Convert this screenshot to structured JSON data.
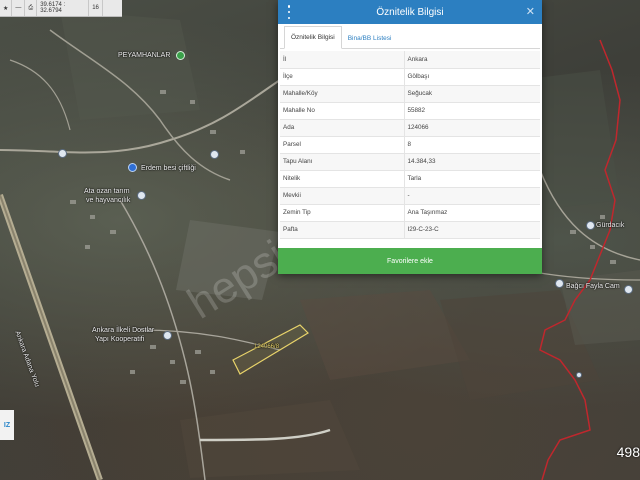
{
  "toolbar": {
    "items": [
      {
        "icon": "star-icon",
        "glyph": "★"
      },
      {
        "icon": "minus-icon",
        "glyph": "—"
      },
      {
        "icon": "print-icon",
        "glyph": "⎙"
      },
      {
        "icon": "coordinates",
        "text": "39.6174 : 32.6794"
      },
      {
        "icon": "zoom-level",
        "text": "16"
      }
    ]
  },
  "map": {
    "labels": {
      "peyamhan": "PEYAMHANLAR",
      "erdem": "Erdem besi çiftliği",
      "ata": "Ata ozan tarım",
      "ata2": "ve hayvancılık",
      "ankara_ilkeli": "Ankara İlkeli Dostlar",
      "yapi": "Yapı Kooperatifi",
      "ankara_road": "Ankara Adana Yolu",
      "gurdacik": "Gürdacık",
      "parcel": "124066/8",
      "right_lbl": "Bağcı Fayla Cam"
    },
    "watermark": "hepsiemlak",
    "corner_number": "498",
    "corner_logo": "IZ",
    "colors": {
      "boundary_red": "#c0272d",
      "parcel_yellow": "#e8d36a"
    }
  },
  "panel": {
    "title": "Öznitelik Bilgisi",
    "tabs": [
      {
        "label": "Öznitelik Bilgisi",
        "active": true
      },
      {
        "label": "Bina/BB Listesi",
        "active": false
      }
    ],
    "rows": [
      {
        "key": "İl",
        "value": "Ankara"
      },
      {
        "key": "İlçe",
        "value": "Gölbaşı"
      },
      {
        "key": "Mahalle/Köy",
        "value": "Seğucak"
      },
      {
        "key": "Mahalle No",
        "value": "55882"
      },
      {
        "key": "Ada",
        "value": "124066"
      },
      {
        "key": "Parsel",
        "value": "8"
      },
      {
        "key": "Tapu Alanı",
        "value": "14.384,33"
      },
      {
        "key": "Nitelik",
        "value": "Tarla"
      },
      {
        "key": "Mevkii",
        "value": "-"
      },
      {
        "key": "Zemin Tip",
        "value": "Ana Taşınmaz"
      },
      {
        "key": "Pafta",
        "value": "I29-C-23-C"
      }
    ],
    "favorite_button": "Favorilere ekle",
    "colors": {
      "header": "#2c7fc1",
      "button": "#4cae4f"
    }
  }
}
